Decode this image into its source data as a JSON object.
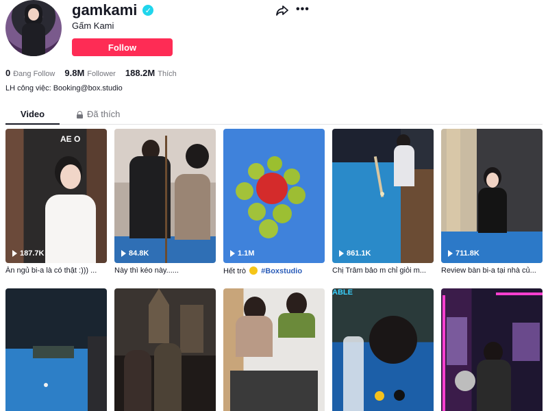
{
  "profile": {
    "username": "gamkami",
    "nickname": "Gấm Kami",
    "follow_label": "Follow",
    "bio": "LH công việc: Booking@box.studio"
  },
  "stats": [
    {
      "value": "0",
      "label": "Đang Follow"
    },
    {
      "value": "9.8M",
      "label": "Follower"
    },
    {
      "value": "188.2M",
      "label": "Thích"
    }
  ],
  "tabs": [
    {
      "label": "Video"
    },
    {
      "label": "Đã thích"
    }
  ],
  "videos": [
    {
      "views": "187.7K",
      "caption": "Ăn ngủ bi-a là có thật :))) ..."
    },
    {
      "views": "84.8K",
      "caption": "Này thì kéo này......"
    },
    {
      "views": "1.1M",
      "caption_pre": "Hết trò",
      "caption_tag": "#Boxstudio"
    },
    {
      "views": "861.1K",
      "caption": "Chị Trâm bảo m chỉ giỏi m..."
    },
    {
      "views": "711.8K",
      "caption": "Review bàn bi-a tại nhà củ..."
    },
    {
      "views": "",
      "caption": ""
    },
    {
      "views": "",
      "caption": ""
    },
    {
      "views": "",
      "caption": ""
    },
    {
      "views": "",
      "caption": ""
    },
    {
      "views": "",
      "caption": ""
    }
  ],
  "colors": {
    "accent": "#fe2c55",
    "verified": "#20d5ec",
    "hashtag": "#2b5db9"
  },
  "icons": [
    "verified-badge-icon",
    "share-icon",
    "more-icon",
    "lock-icon",
    "play-icon",
    "laughing-emoji-icon"
  ]
}
